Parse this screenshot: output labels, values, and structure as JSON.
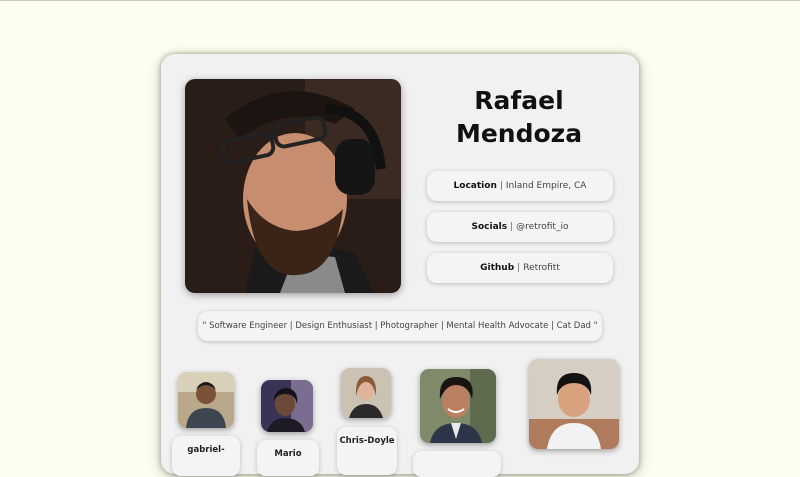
{
  "profile": {
    "name": "Rafael Mendoza",
    "location_label": "Location",
    "location_value": "Inland Empire, CA",
    "socials_label": "Socials",
    "socials_value": "@retrofit_io",
    "github_label": "Github",
    "github_value": "Retrofitt",
    "separator": "|",
    "tagline": "\" Software Engineer | Design Enthusiast | Photographer | Mental Health Advocate | Cat Dad \""
  },
  "friends": [
    {
      "label": "gabriel-",
      "icon": "friend-avatar"
    },
    {
      "label": "Mario",
      "icon": "friend-avatar"
    },
    {
      "label": "Chris-Doyle",
      "icon": "friend-avatar"
    },
    {
      "label": "",
      "icon": "friend-avatar"
    },
    {
      "label": "",
      "icon": "friend-avatar"
    }
  ],
  "colors": {
    "page_background": "#fdfdf1",
    "card_background": "#f1f1f1",
    "text": "#111111"
  }
}
